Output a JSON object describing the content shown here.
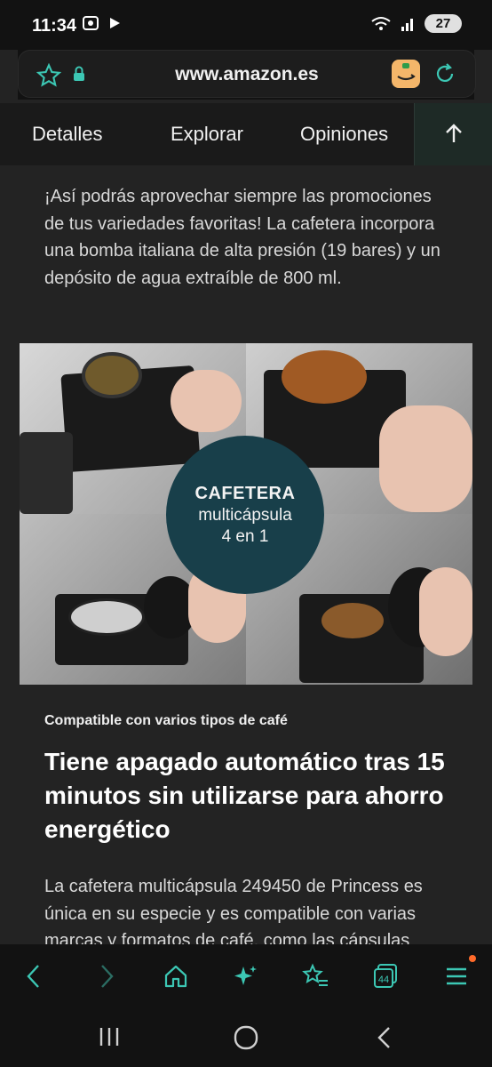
{
  "status_bar": {
    "time": "11:34",
    "battery": "27"
  },
  "browser": {
    "url": "www.amazon.es"
  },
  "tabs": [
    {
      "label": "Detalles"
    },
    {
      "label": "Explorar"
    },
    {
      "label": "Opiniones"
    }
  ],
  "content": {
    "paragraph_1": "¡Así podrás aprovechar siempre las promociones de tus variedades favoritas! La cafetera incorpora una bomba italiana de alta presión (19 bares) y un depósito de agua extraíble de 800 ml.",
    "image_badge": {
      "title": "CAFETERA",
      "line2": "multicápsula",
      "line3": "4 en 1"
    },
    "subheading": "Compatible con varios tipos de café",
    "heading": "Tiene apagado automático tras 15 minutos sin utilizarse para ahorro energético",
    "paragraph_2": "La cafetera multicápsula 249450 de Princess es única en su especie y es compatible con varias marcas y formatos de café, como las cápsulas"
  },
  "bottom_toolbar": {
    "tabs_count": "44"
  },
  "colors": {
    "accent": "#3cc7b4",
    "background": "#232323",
    "badge": "#183f4a"
  }
}
